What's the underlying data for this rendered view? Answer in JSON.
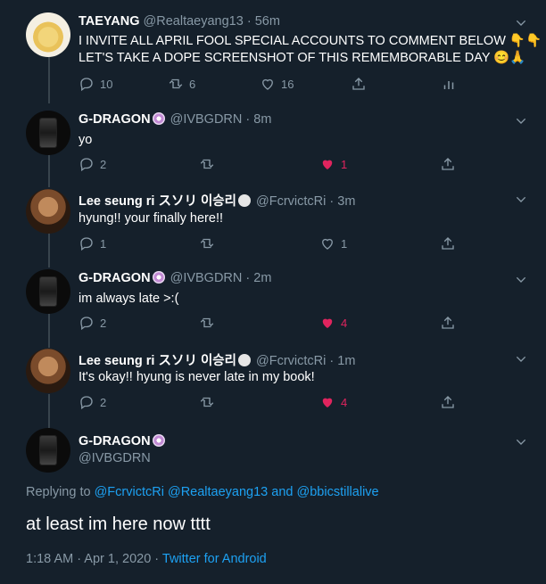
{
  "colors": {
    "background": "#15202b",
    "text": "#ffffff",
    "secondary": "#8899a6",
    "link": "#1da1f2",
    "like": "#e0245e",
    "border": "#38444d"
  },
  "tweets": [
    {
      "name": "TAEYANG",
      "handle": "@Realtaeyang13",
      "time": "· 56m",
      "text_line1": "I INVITE ALL APRIL FOOL SPECIAL ACCOUNTS TO COMMENT BELOW 👇👇",
      "text_line2": " LET'S TAKE A DOPE SCREENSHOT OF THIS REMEMBORABLE DAY 😊🙏",
      "replies": "10",
      "retweets": "6",
      "likes": "16"
    },
    {
      "name": "G-DRAGON",
      "handle": "@IVBGDRN",
      "time": "· 8m",
      "text": "yo",
      "replies": "2",
      "likes": "1"
    },
    {
      "name": "Lee seung ri スソリ 이승리",
      "handle": "@FcrvictcRi",
      "time": "· 3m",
      "text": "hyung!! your finally here!!",
      "replies": "1",
      "likes": "1"
    },
    {
      "name": "G-DRAGON",
      "handle": "@IVBGDRN",
      "time": "· 2m",
      "text": "im always late >:(",
      "replies": "2",
      "likes": "4"
    },
    {
      "name": "Lee seung ri スソリ 이승리",
      "handle": "@FcrvictcRi",
      "time": "· 1m",
      "text": "It's okay!! hyung is never late in my book!",
      "replies": "2",
      "likes": "4"
    }
  ],
  "main": {
    "name": "G-DRAGON",
    "handle": "@IVBGDRN",
    "replying_to_label": "Replying to",
    "reply_user1": "@FcrvictcRi",
    "reply_user2": "@Realtaeyang13",
    "and": "and",
    "reply_user3": "@bbicstillalive",
    "text": "at least im here now tttt",
    "timestamp": "1:18 AM · Apr 1, 2020 · ",
    "source": "Twitter for Android"
  }
}
